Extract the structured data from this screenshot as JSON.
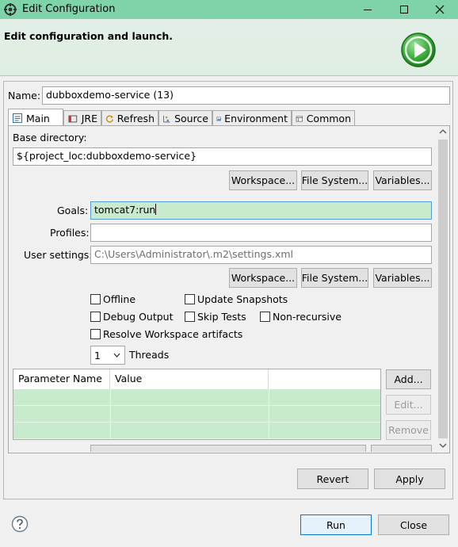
{
  "window": {
    "title": "Edit Configuration",
    "header_title": "Edit configuration and launch."
  },
  "name_field": {
    "label": "Name:",
    "value": "dubboxdemo-service (13)"
  },
  "tabs": [
    {
      "label": "Main",
      "icon": "main-tab-icon",
      "active": true
    },
    {
      "label": "JRE",
      "icon": "jre-icon"
    },
    {
      "label": "Refresh",
      "icon": "refresh-icon"
    },
    {
      "label": "Source",
      "icon": "source-icon"
    },
    {
      "label": "Environment",
      "icon": "environment-icon"
    },
    {
      "label": "Common",
      "icon": "common-icon"
    }
  ],
  "main": {
    "base_dir_label": "Base directory:",
    "base_dir_value": "${project_loc:dubboxdemo-service}",
    "workspace_btn": "Workspace...",
    "filesystem_btn": "File System...",
    "variables_btn": "Variables...",
    "goals_label": "Goals:",
    "goals_value": "tomcat7:run",
    "profiles_label": "Profiles:",
    "profiles_value": "",
    "user_settings_label": "User settings:",
    "user_settings_value": "C:\\Users\\Administrator\\.m2\\settings.xml",
    "offline_label": "Offline",
    "update_snapshots_label": "Update Snapshots",
    "debug_output_label": "Debug Output",
    "skip_tests_label": "Skip Tests",
    "non_recursive_label": "Non-recursive",
    "resolve_workspace_label": "Resolve Workspace artifacts",
    "threads_value": "1",
    "threads_label": "Threads",
    "table": {
      "columns": [
        "Parameter Name",
        "Value"
      ],
      "rows": [
        [
          "",
          ""
        ],
        [
          "",
          ""
        ],
        [
          "",
          ""
        ]
      ]
    },
    "add_btn": "Add...",
    "edit_btn": "Edit...",
    "remove_btn": "Remove"
  },
  "revert_btn": "Revert",
  "apply_btn": "Apply",
  "run_btn": "Run",
  "close_btn": "Close",
  "colors": {
    "titlebar": "#7fd3a9",
    "goals_field_bg": "#c8ebce",
    "table_row_bg": "#c8ebce",
    "run_icon_green": "#3cae3c"
  }
}
